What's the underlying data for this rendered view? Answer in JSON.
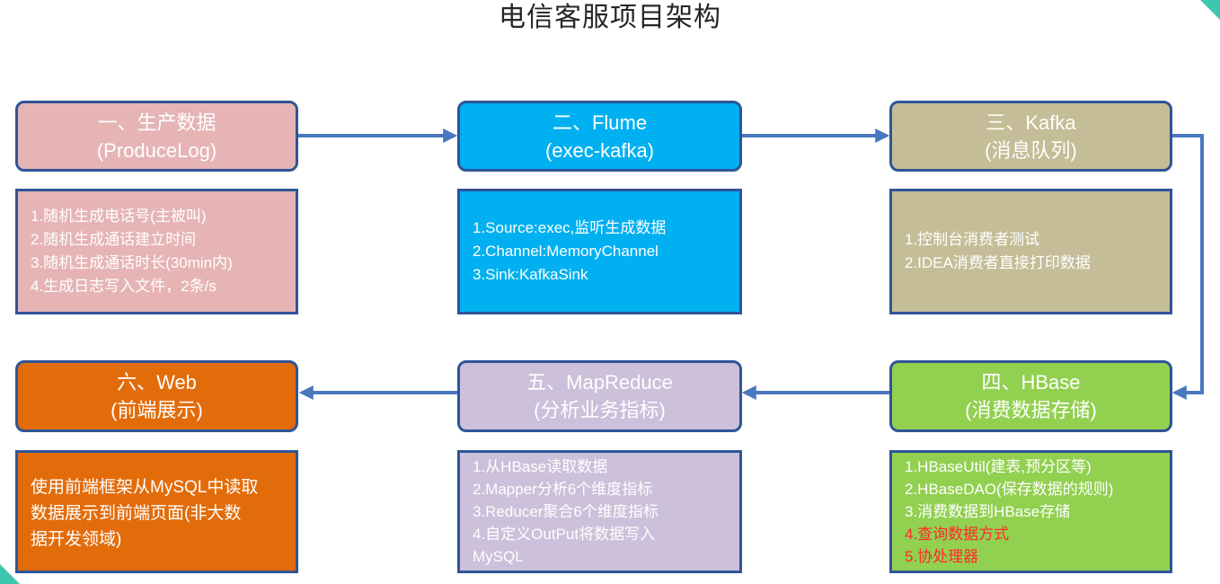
{
  "title": "电信客服项目架构",
  "colors": {
    "border": "#2f5597",
    "connector": "#4a78c0",
    "alert_text": "#ff2a2a"
  },
  "stages": [
    {
      "key": "produce",
      "line1": "一、生产数据",
      "line2": "(ProduceLog)",
      "fill": "#e6b4b5",
      "details": [
        "1.随机生成电话号(主被叫)",
        "2.随机生成通话建立时间",
        "3.随机生成通话时长(30min内)",
        "4.生成日志写入文件，2条/s"
      ]
    },
    {
      "key": "flume",
      "line1": "二、Flume",
      "line2": "(exec-kafka)",
      "fill": "#00b0f0",
      "details": [
        "1.Source:exec,监听生成数据",
        "2.Channel:MemoryChannel",
        "3.Sink:KafkaSink"
      ]
    },
    {
      "key": "kafka",
      "line1": "三、Kafka",
      "line2": "(消息队列)",
      "fill": "#c4bd97",
      "details": [
        "1.控制台消费者测试",
        "2.IDEA消费者直接打印数据"
      ]
    },
    {
      "key": "hbase",
      "line1": "四、HBase",
      "line2": "(消费数据存储)",
      "fill": "#92d050",
      "details": [
        "1.HBaseUtil(建表,预分区等)",
        "2.HBaseDAO(保存数据的规则)",
        "3.消费数据到HBase存储",
        "4.查询数据方式",
        "5.协处理器"
      ]
    },
    {
      "key": "mapreduce",
      "line1": "五、MapReduce",
      "line2": "(分析业务指标)",
      "fill": "#ccc0da",
      "details": [
        "1.从HBase读取数据",
        "2.Mapper分析6个维度指标",
        "3.Reducer聚合6个维度指标",
        "4.自定义OutPut将数据写入",
        "MySQL"
      ]
    },
    {
      "key": "web",
      "line1": "六、Web",
      "line2": "(前端展示)",
      "fill": "#e36c0a",
      "details": [
        "使用前端框架从MySQL中读取",
        "数据展示到前端页面(非大数",
        "据开发领域)"
      ]
    }
  ]
}
